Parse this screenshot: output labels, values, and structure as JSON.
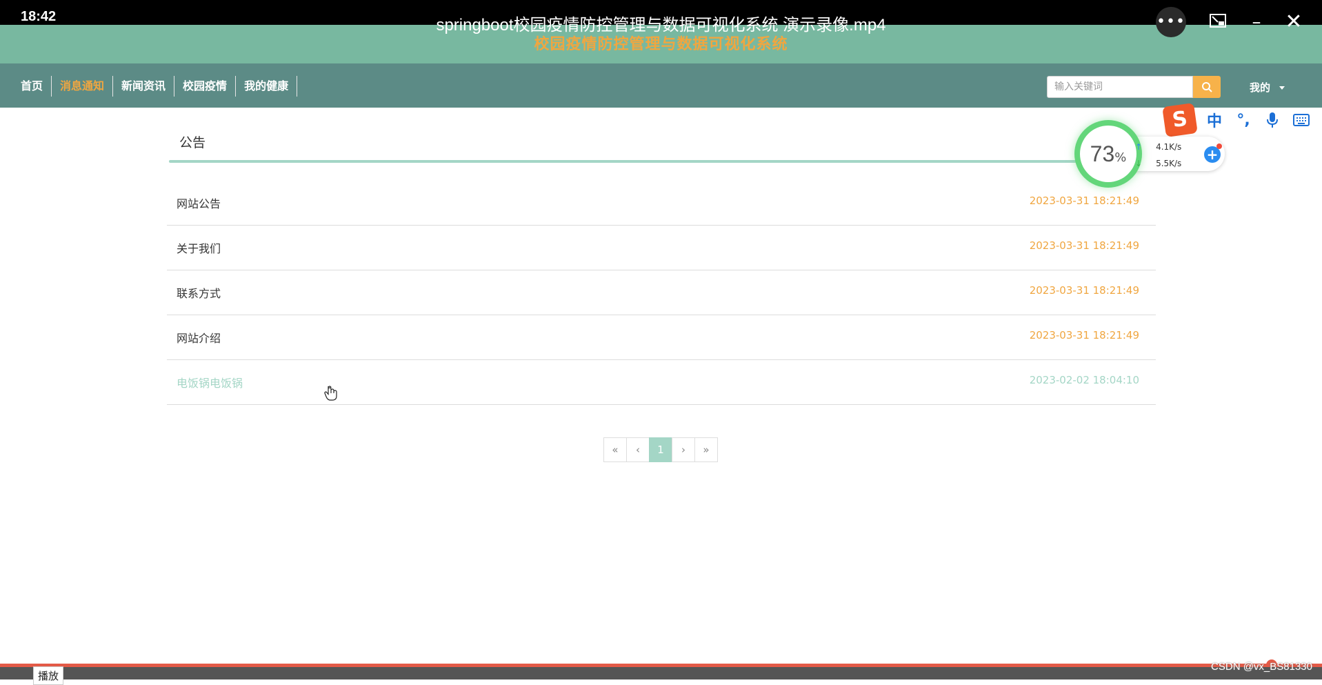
{
  "player": {
    "time": "18:42",
    "title": "springboot校园疫情防控管理与数据可视化系统 演示录像.mp4",
    "more_icon": "more-dots-icon",
    "pip_icon": "picture-in-picture-icon",
    "minimize_icon": "minimize-icon",
    "close_icon": "close-icon",
    "play_tooltip": "播放",
    "watermark": "CSDN @vx_BS81330",
    "progress_percent": 96
  },
  "site": {
    "title": "校园疫情防控管理与数据可视化系统"
  },
  "nav": {
    "items": [
      {
        "label": "首页",
        "active": false
      },
      {
        "label": "消息通知",
        "active": true
      },
      {
        "label": "新闻资讯",
        "active": false
      },
      {
        "label": "校园疫情",
        "active": false
      },
      {
        "label": "我的健康",
        "active": false
      }
    ],
    "search_placeholder": "输入关键词",
    "my_label": "我的"
  },
  "section": {
    "heading": "公告"
  },
  "notices": [
    {
      "title": "网站公告",
      "date": "2023-03-31 18:21:49"
    },
    {
      "title": "关于我们",
      "date": "2023-03-31 18:21:49"
    },
    {
      "title": "联系方式",
      "date": "2023-03-31 18:21:49"
    },
    {
      "title": "网站介绍",
      "date": "2023-03-31 18:21:49"
    },
    {
      "title": "电饭锅电饭锅",
      "date": "2023-02-02 18:04:10"
    }
  ],
  "pagination": {
    "first": "«",
    "prev": "‹",
    "current": "1",
    "next": "›",
    "last": "»"
  },
  "ime": {
    "logo": "S",
    "mode": "中",
    "punct": "°,"
  },
  "speed_widget": {
    "percent": "73",
    "percent_unit": "%",
    "up_arrow": "↑",
    "up": "4.1K/s",
    "down_arrow": "↓",
    "down": "5.5K/s",
    "add": "+"
  },
  "colors": {
    "header_bg": "#78b8a0",
    "nav_bg": "#5c8b86",
    "accent_orange": "#f0a640",
    "accent_green": "#a4d6c6",
    "progress_red": "#e35a47"
  }
}
